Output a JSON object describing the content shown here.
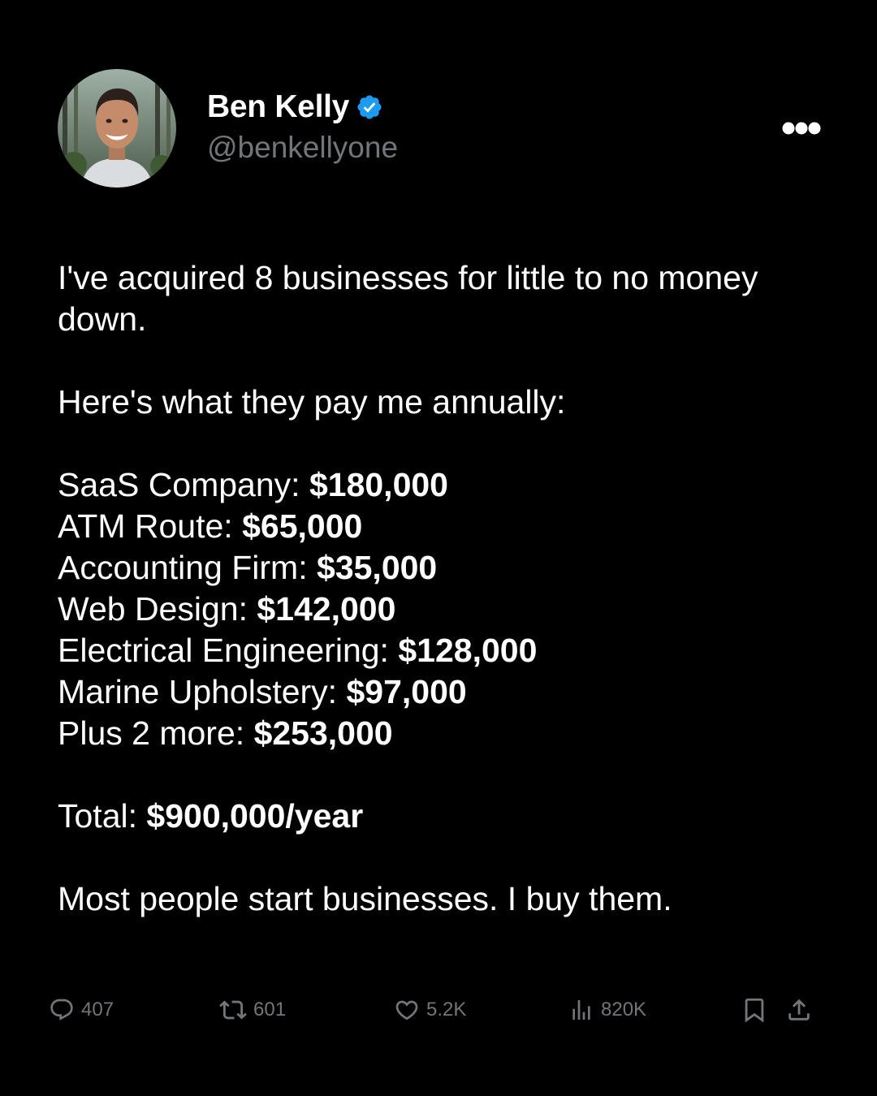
{
  "author": {
    "display_name": "Ben Kelly",
    "handle": "@benkellyone",
    "verified": true,
    "verified_color": "#1d9bf0"
  },
  "tweet": {
    "intro": "I've acquired 8 businesses for little to no money down.",
    "lead": "Here's what they pay me annually:",
    "items": [
      {
        "label": "SaaS Company:",
        "amount": "$180,000"
      },
      {
        "label": "ATM Route:",
        "amount": "$65,000"
      },
      {
        "label": "Accounting Firm:",
        "amount": "$35,000"
      },
      {
        "label": "Web Design:",
        "amount": "$142,000"
      },
      {
        "label": "Electrical Engineering:",
        "amount": "$128,000"
      },
      {
        "label": "Marine Upholstery:",
        "amount": "$97,000"
      },
      {
        "label": "Plus 2 more:",
        "amount": "$253,000"
      }
    ],
    "total": {
      "label": "Total:",
      "amount": "$900,000/year"
    },
    "closing": "Most people start businesses. I buy them."
  },
  "actions": {
    "replies": "407",
    "reposts": "601",
    "likes": "5.2K",
    "views": "820K"
  },
  "icons": {
    "more": "more-dots-icon",
    "reply": "reply-icon",
    "repost": "repost-icon",
    "like": "heart-icon",
    "views": "views-chart-icon",
    "bookmark": "bookmark-icon",
    "share": "share-icon"
  },
  "colors": {
    "background": "#000000",
    "text": "#ffffff",
    "muted": "#71767b"
  }
}
